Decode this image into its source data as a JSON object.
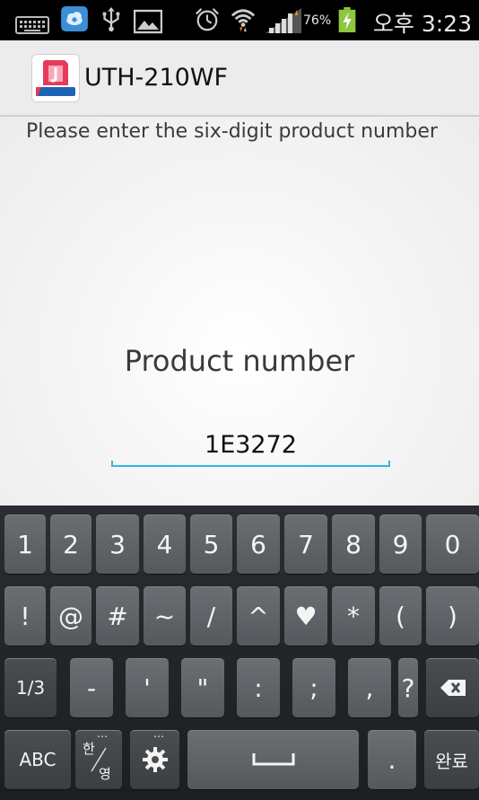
{
  "status_bar": {
    "battery_percent": "76%",
    "time": "오후 3:23",
    "icons": [
      "keyboard-icon",
      "cloud-icon",
      "usb-icon",
      "gallery-icon",
      "alarm-icon",
      "wifi-icon",
      "signal-icon",
      "battery-charging-icon"
    ]
  },
  "action_bar": {
    "title": "UTH-210WF",
    "logo": "app-logo"
  },
  "content": {
    "instruction": "Please enter the six-digit product number",
    "field_label": "Product number",
    "field_value": "1E3272"
  },
  "keyboard": {
    "row1": [
      "1",
      "2",
      "3",
      "4",
      "5",
      "6",
      "7",
      "8",
      "9",
      "0"
    ],
    "row2": [
      "!",
      "@",
      "#",
      "~",
      "/",
      "^",
      "♥",
      "*",
      "(",
      ")"
    ],
    "row3": [
      "1/3",
      "-",
      "'",
      "\"",
      ":",
      ";",
      ",",
      "?"
    ],
    "row4": {
      "abc": "ABC",
      "lang_top": "한",
      "lang_bottom": "영",
      "period": ".",
      "done": "완료"
    }
  },
  "colors": {
    "accent": "#33b5e5",
    "keyboard_bg": "#24272b",
    "key_bg": "#606367"
  }
}
